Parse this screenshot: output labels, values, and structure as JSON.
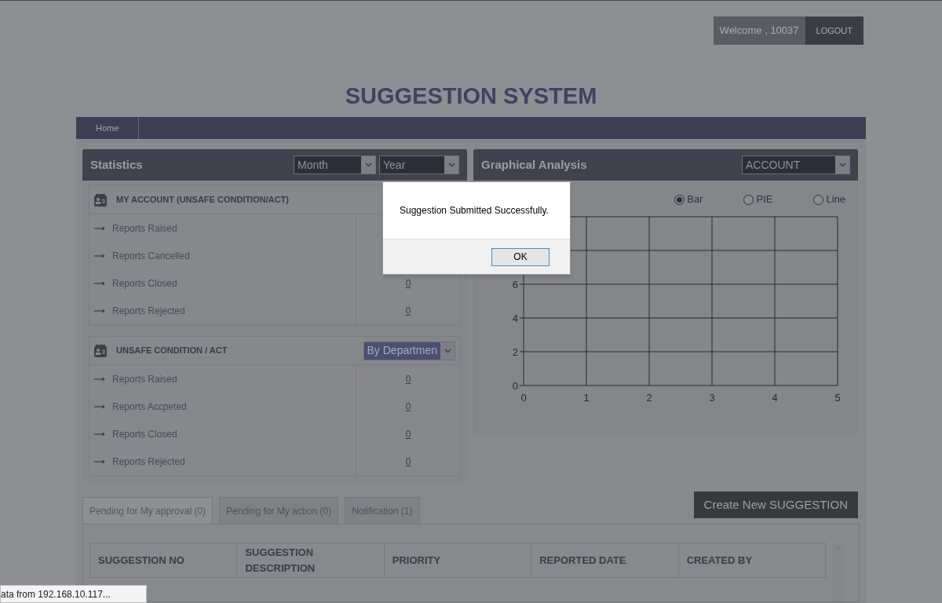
{
  "header": {
    "welcome": "Welcome , 10037",
    "logout": "LOGOUT"
  },
  "title": "SUGGESTION SYSTEM",
  "nav": [
    {
      "label": "Home"
    }
  ],
  "statistics": {
    "title": "Statistics",
    "month": "Month",
    "year": "Year",
    "sections": [
      {
        "title": "MY ACCOUNT (UNSAFE CONDITION/ACT)",
        "rows": [
          {
            "label": "Reports Raised"
          },
          {
            "label": "Reports Cancelled"
          },
          {
            "label": "Reports Closed",
            "value": "0"
          },
          {
            "label": "Reports Rejected",
            "value": "0"
          }
        ]
      },
      {
        "title": "UNSAFE CONDITION / ACT",
        "filter": "By Departmen",
        "rows": [
          {
            "label": "Reports Raised",
            "value": "0"
          },
          {
            "label": "Reports Accpeted",
            "value": "0"
          },
          {
            "label": "Reports Closed",
            "value": "0"
          },
          {
            "label": "Reports Rejected",
            "value": "0"
          }
        ]
      }
    ]
  },
  "graphical_analysis": {
    "title": "Graphical Analysis",
    "account": "ACCOUNT",
    "chart_types": [
      {
        "label": "Bar",
        "selected": true
      },
      {
        "label": "PIE",
        "selected": false
      },
      {
        "label": "Line",
        "selected": false
      }
    ],
    "chart_data": {
      "type": "bar",
      "grid": true,
      "xlim": [
        0,
        5
      ],
      "ylim": [
        0,
        10
      ],
      "xticks": [
        0,
        1,
        2,
        3,
        4,
        5
      ],
      "yticks": [
        0,
        2,
        4,
        6
      ]
    }
  },
  "tabs": [
    {
      "label": "Pending for My approval (0)",
      "selected": true
    },
    {
      "label": "Pending for My action (0)",
      "selected": false
    },
    {
      "label": "Notification (1)",
      "selected": false
    }
  ],
  "create_button": "Create New SUGGESTION",
  "table": {
    "columns": [
      "SUGGESTION NO",
      "SUGGESTION DESCRIPTION",
      "PRIORITY",
      "REPORTED DATE",
      "CREATED BY"
    ]
  },
  "dialog": {
    "message": "Suggestion Submitted Successfully.",
    "ok": "OK"
  },
  "status_bar": "ata from 192.168.10.117..."
}
